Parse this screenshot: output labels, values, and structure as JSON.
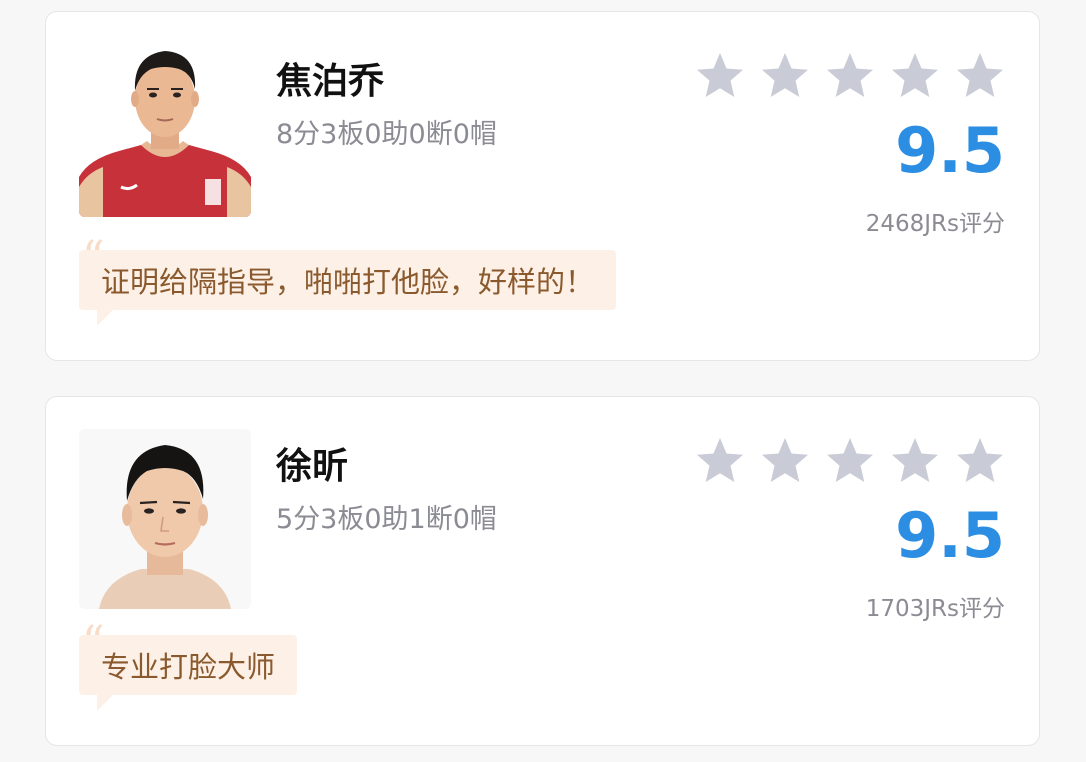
{
  "colors": {
    "score": "#2c8ee3",
    "star": "#c9ccd6",
    "comment_bg": "#fdf0e6",
    "comment_text": "#8a5a2e"
  },
  "players": [
    {
      "name": "焦泊乔",
      "stats": "8分3板0助0断0帽",
      "stars": 5,
      "score": "9.5",
      "rating_count": "2468JRs评分",
      "comment": "证明给隔指导，啪啪打他脸，好样的！"
    },
    {
      "name": "徐昕",
      "stats": "5分3板0助1断0帽",
      "stars": 5,
      "score": "9.5",
      "rating_count": "1703JRs评分",
      "comment": "专业打脸大师"
    }
  ]
}
